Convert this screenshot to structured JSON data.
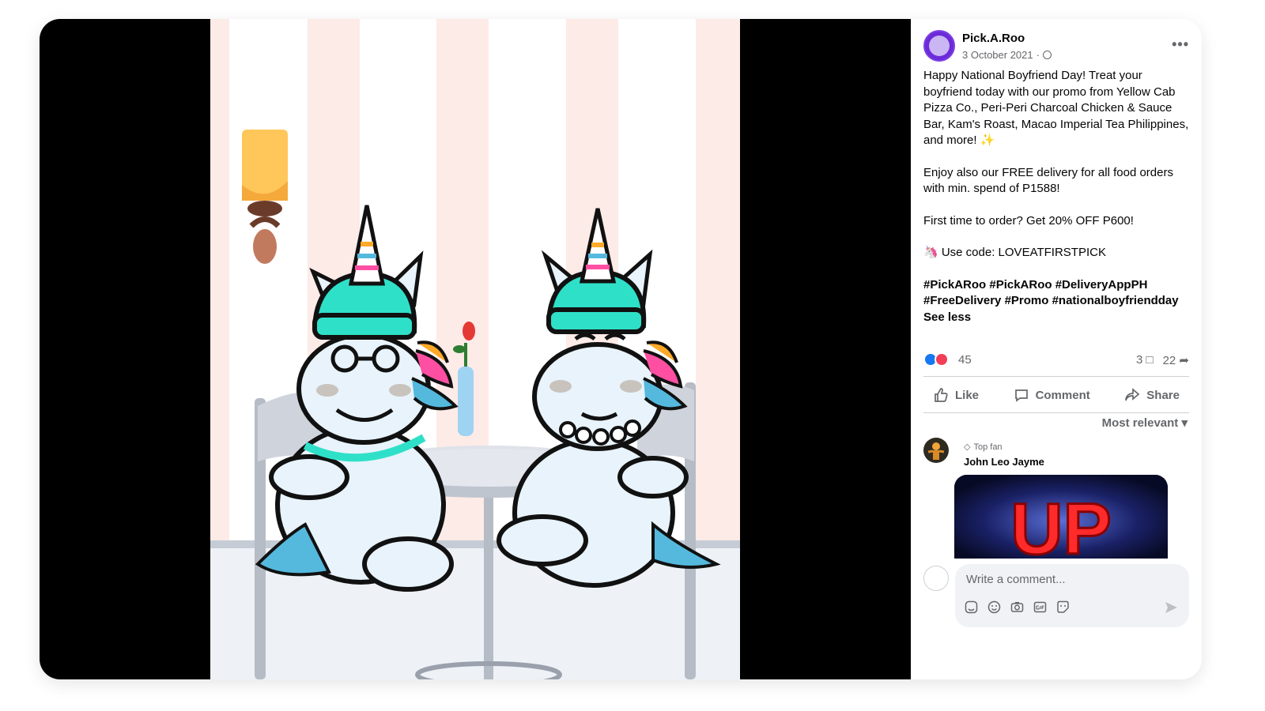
{
  "post": {
    "page_name": "Pick.A.Roo",
    "date": "3 October 2021",
    "date_separator": " ·",
    "more_label": "•••",
    "text_paragraph_1": "Happy National Boyfriend Day! Treat your boyfriend today with our promo from Yellow Cab Pizza Co., Peri-Peri Charcoal Chicken & Sauce Bar, Kam's Roast, Macao Imperial Tea Philippines, and more! ✨",
    "text_paragraph_2": "Enjoy also our FREE delivery for all food orders with min. spend of P1588!",
    "text_paragraph_3": "First time to order? Get 20% OFF P600!",
    "text_paragraph_4": "🦄 Use code: LOVEATFIRSTPICK",
    "hashtags_line_1": "#PickARoo #PickARoo #DeliveryAppPH",
    "hashtags_line_2": "#FreeDelivery #Promo #nationalboyfriendday",
    "see_less": "See less"
  },
  "reactions": {
    "count": "45",
    "comments": "3",
    "shares": "22",
    "like_color": "#1877f2",
    "love_color": "#f33e58"
  },
  "actions": {
    "like": "Like",
    "comment": "Comment",
    "share": "Share"
  },
  "comments": {
    "sort_label": "Most relevant",
    "items": [
      {
        "badge": "Top fan",
        "author": "John Leo Jayme",
        "gif_text": "UP"
      }
    ],
    "composer_placeholder": "Write a comment..."
  },
  "icons": {
    "tools": [
      "avatar-sticker-icon",
      "emoji-icon",
      "camera-icon",
      "gif-icon",
      "sticker-icon"
    ]
  },
  "colors": {
    "accent": "#1877f2",
    "secondary_text": "#65676b",
    "unicorn_helmet": "#2fe0c8",
    "wall_stripe": "#fdebe7"
  }
}
